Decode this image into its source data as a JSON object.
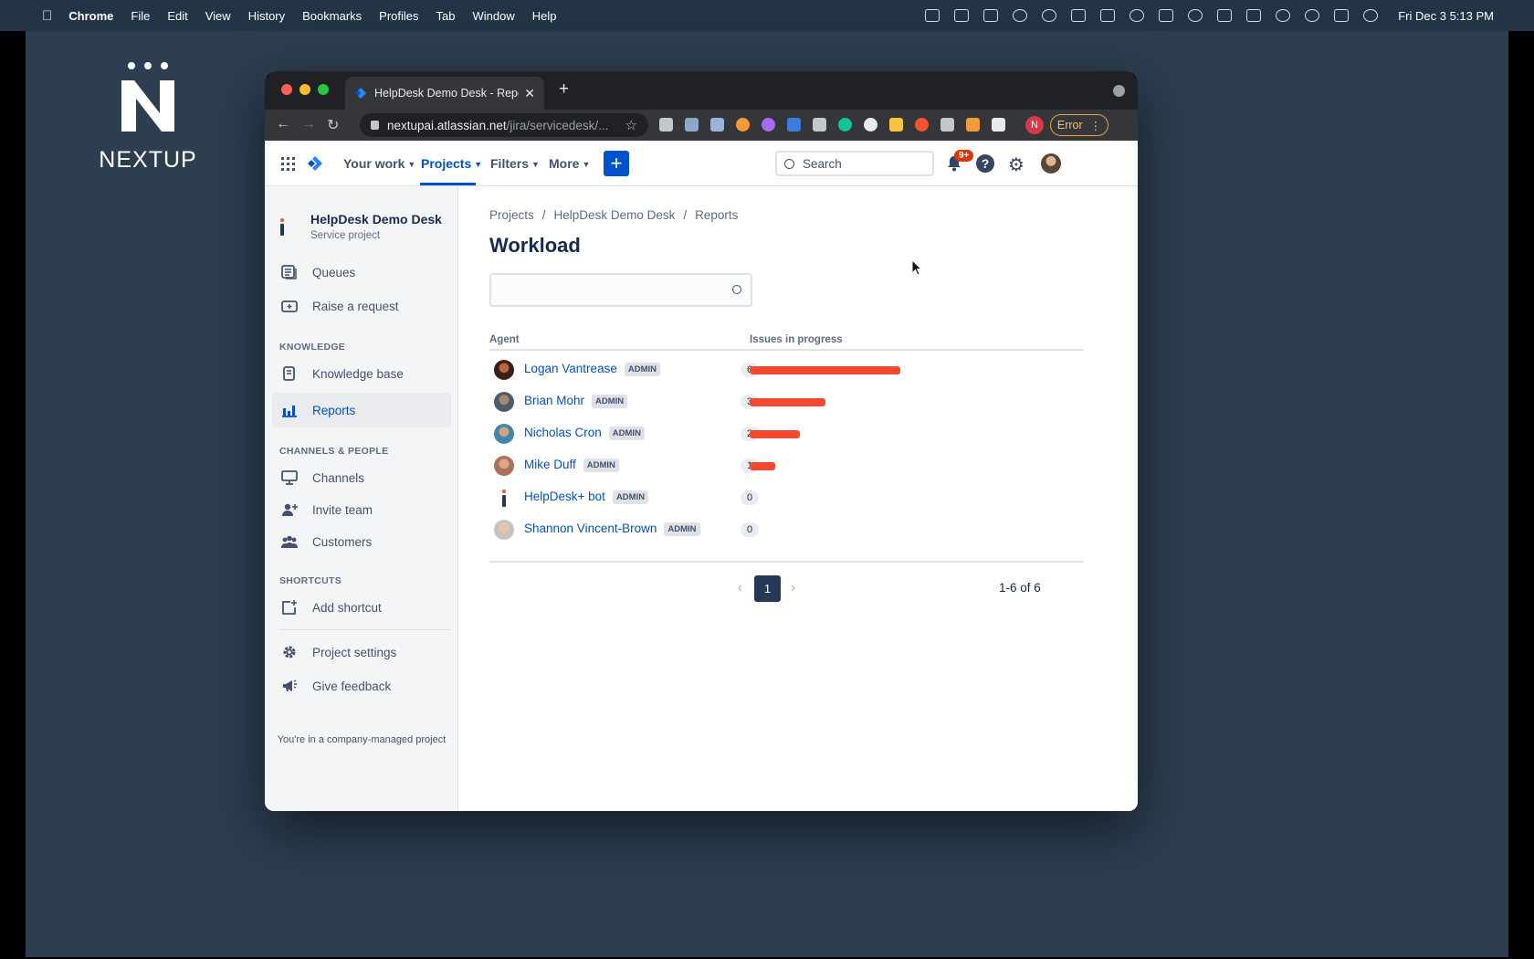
{
  "menubar": {
    "app": "Chrome",
    "items": [
      "File",
      "Edit",
      "View",
      "History",
      "Bookmarks",
      "Profiles",
      "Tab",
      "Window",
      "Help"
    ],
    "clock": "Fri Dec 3  5:13 PM"
  },
  "desktop_logo": {
    "wordmark": "NEXTUP"
  },
  "browser": {
    "tab_title": "HelpDesk Demo Desk - Reports",
    "url_host": "nextupai.atlassian.net",
    "url_path": "/jira/servicedesk/...",
    "profile_letter": "N",
    "error_label": "Error"
  },
  "jira_nav": {
    "your_work": "Your work",
    "projects": "Projects",
    "filters": "Filters",
    "more": "More",
    "search_placeholder": "Search",
    "notification_badge": "9+"
  },
  "sidebar": {
    "project_name": "HelpDesk Demo Desk",
    "project_type": "Service project",
    "queues": "Queues",
    "raise_request": "Raise a request",
    "knowledge_header": "KNOWLEDGE",
    "knowledge_base": "Knowledge base",
    "reports": "Reports",
    "channels_header": "CHANNELS & PEOPLE",
    "channels": "Channels",
    "invite_team": "Invite team",
    "customers": "Customers",
    "shortcuts_header": "SHORTCUTS",
    "add_shortcut": "Add shortcut",
    "project_settings": "Project settings",
    "give_feedback": "Give feedback",
    "footer": "You're in a company-managed project"
  },
  "main": {
    "breadcrumbs": [
      "Projects",
      "HelpDesk Demo Desk",
      "Reports"
    ],
    "title": "Workload",
    "col_agent": "Agent",
    "col_issues": "Issues in progress",
    "agents": [
      {
        "name": "Logan Vantrease",
        "lozenge": "ADMIN",
        "count": "6",
        "value": 6
      },
      {
        "name": "Brian Mohr",
        "lozenge": "ADMIN",
        "count": "3",
        "value": 3
      },
      {
        "name": "Nicholas Cron",
        "lozenge": "ADMIN",
        "count": "2",
        "value": 2
      },
      {
        "name": "Mike Duff",
        "lozenge": "ADMIN",
        "count": "1",
        "value": 1
      },
      {
        "name": "HelpDesk+ bot",
        "lozenge": "ADMIN",
        "count": "0",
        "value": 0
      },
      {
        "name": "Shannon Vincent-Brown",
        "lozenge": "ADMIN",
        "count": "0",
        "value": 0
      }
    ],
    "page": "1",
    "page_count": "1-6 of 6"
  },
  "colors": {
    "desktop": "#2c3e50",
    "jira_blue": "#0052cc",
    "bar": "#f5492f"
  }
}
